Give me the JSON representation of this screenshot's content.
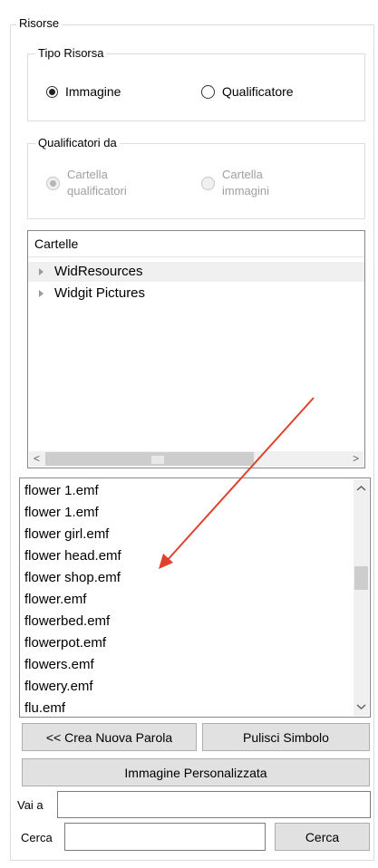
{
  "risorse_legend": "Risorse",
  "tipo_risorsa": {
    "legend": "Tipo Risorsa",
    "options": [
      {
        "label": "Immagine",
        "selected": true
      },
      {
        "label": "Qualificatore",
        "selected": false
      }
    ]
  },
  "qualificatori_da": {
    "legend": "Qualificatori da",
    "options": [
      {
        "line1": "Cartella",
        "line2": "qualificatori",
        "selected": true,
        "disabled": true
      },
      {
        "line1": "Cartella",
        "line2": "immagini",
        "selected": false,
        "disabled": true
      }
    ]
  },
  "folders": {
    "header": "Cartelle",
    "items": [
      "WidResources",
      "Widgit Pictures"
    ],
    "scroll_left": "<",
    "scroll_right": ">"
  },
  "files": [
    "flower 1.emf",
    "flower 1.emf",
    "flower girl.emf",
    "flower head.emf",
    "flower shop.emf",
    "flower.emf",
    "flowerbed.emf",
    "flowerpot.emf",
    "flowers.emf",
    "flowery.emf",
    "flu.emf"
  ],
  "buttons": {
    "crea_nuova_parola": "<< Crea Nuova Parola",
    "pulisci_simbolo": "Pulisci Simbolo",
    "immagine_personalizzata": "Immagine Personalizzata",
    "cerca": "Cerca"
  },
  "vai_a": {
    "label": "Vai a",
    "value": ""
  },
  "cerca_field": {
    "label": "Cerca",
    "value": ""
  },
  "colors": {
    "annotation_arrow": "#e0412c",
    "selected_row": "#f0f0f0"
  }
}
